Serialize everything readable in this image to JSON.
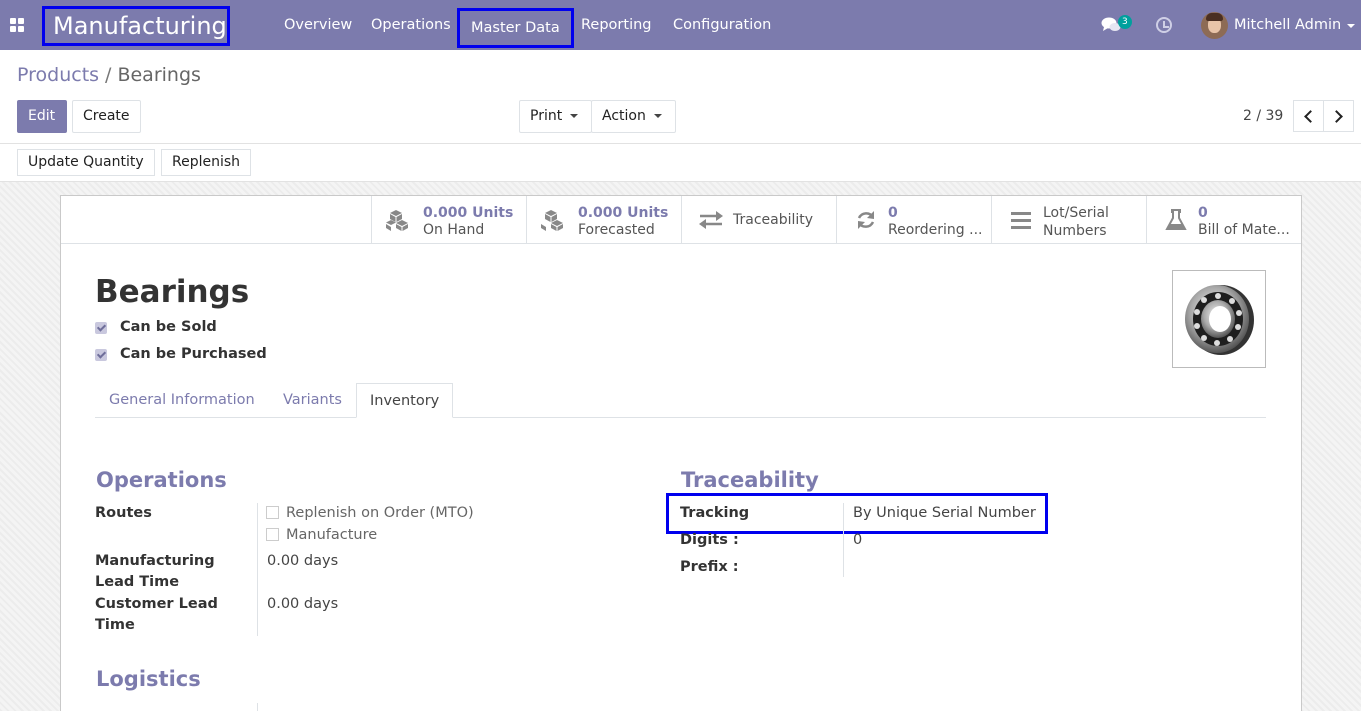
{
  "navbar": {
    "app_name": "Manufacturing",
    "menu": [
      "Overview",
      "Operations",
      "Master Data",
      "Reporting",
      "Configuration"
    ],
    "messages_count": "3",
    "user_name": "Mitchell Admin"
  },
  "breadcrumb": {
    "parent": "Products",
    "separator": "/",
    "current": "Bearings"
  },
  "buttons": {
    "edit": "Edit",
    "create": "Create",
    "print": "Print",
    "action": "Action",
    "update_quantity": "Update Quantity",
    "replenish": "Replenish"
  },
  "pager": {
    "value": "2 / 39"
  },
  "smart_buttons": {
    "on_hand": {
      "value": "0.000 Units",
      "label": "On Hand",
      "icon": "cubes-icon"
    },
    "forecasted": {
      "value": "0.000 Units",
      "label": "Forecasted",
      "icon": "cubes-icon"
    },
    "traceability": {
      "label": "Traceability",
      "icon": "exchange-icon"
    },
    "reordering": {
      "value": "0",
      "label": "Reordering ...",
      "icon": "refresh-icon"
    },
    "lots": {
      "label1": "Lot/Serial",
      "label2": "Numbers",
      "icon": "list-icon"
    },
    "bom": {
      "value": "0",
      "label": "Bill of Mate...",
      "icon": "flask-icon"
    }
  },
  "product": {
    "name": "Bearings",
    "can_be_sold": "Can be Sold",
    "can_be_purchased": "Can be Purchased"
  },
  "tabs": [
    "General Information",
    "Variants",
    "Inventory"
  ],
  "operations": {
    "title": "Operations",
    "routes_label": "Routes",
    "routes": [
      "Replenish on Order (MTO)",
      "Manufacture"
    ],
    "mfg_lead_label_1": "Manufacturing",
    "mfg_lead_label_2": "Lead Time",
    "mfg_lead_value": "0.00 days",
    "cust_lead_label_1": "Customer Lead",
    "cust_lead_label_2": "Time",
    "cust_lead_value": "0.00 days"
  },
  "traceability": {
    "title": "Traceability",
    "tracking_label": "Tracking",
    "tracking_value": "By Unique Serial Number",
    "digits_label": "Digits :",
    "digits_value": "0",
    "prefix_label": "Prefix :"
  },
  "logistics": {
    "title": "Logistics"
  },
  "colors": {
    "brand": "#7c7bad",
    "highlight": "#0000ee",
    "badge": "#00a09d"
  }
}
